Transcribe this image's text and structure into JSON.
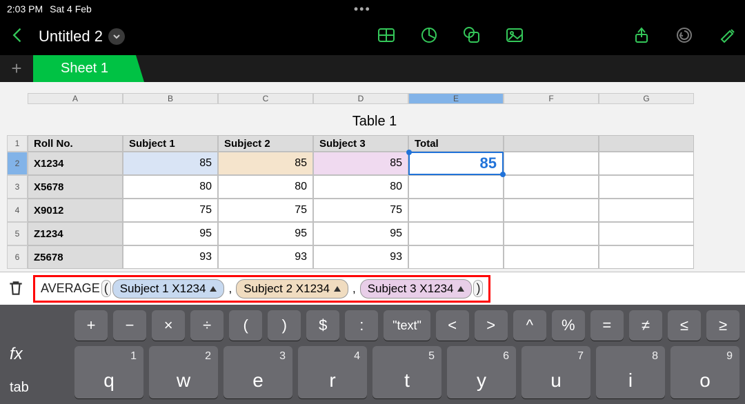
{
  "status": {
    "time": "2:03 PM",
    "date": "Sat 4 Feb"
  },
  "toolbar": {
    "back": "back",
    "title": "Untitled 2"
  },
  "tabbar": {
    "add": "+",
    "tab1": "Sheet 1"
  },
  "table": {
    "title": "Table 1",
    "cols": [
      "A",
      "B",
      "C",
      "D",
      "E",
      "F",
      "G"
    ],
    "rownums": [
      "1",
      "2",
      "3",
      "4",
      "5",
      "6"
    ],
    "headers": {
      "a": "Roll No.",
      "b": "Subject 1",
      "c": "Subject 2",
      "d": "Subject 3",
      "e": "Total"
    },
    "rows": [
      {
        "a": "X1234",
        "b": "85",
        "c": "85",
        "d": "85",
        "e": "85"
      },
      {
        "a": "X5678",
        "b": "80",
        "c": "80",
        "d": "80",
        "e": ""
      },
      {
        "a": "X9012",
        "b": "75",
        "c": "75",
        "d": "75",
        "e": ""
      },
      {
        "a": "Z1234",
        "b": "95",
        "c": "95",
        "d": "95",
        "e": ""
      },
      {
        "a": "Z5678",
        "b": "93",
        "c": "93",
        "d": "93",
        "e": ""
      }
    ]
  },
  "formula": {
    "fn": "AVERAGE",
    "args": [
      {
        "label": "Subject 1 X1234"
      },
      {
        "label": "Subject 2 X1234"
      },
      {
        "label": "Subject 3 X1234"
      }
    ],
    "sep": ","
  },
  "keyboard": {
    "fx": "fx",
    "tab": "tab",
    "ops": [
      "+",
      "−",
      "×",
      "÷",
      "(",
      ")",
      "$",
      ":",
      "\"text\"",
      "<",
      ">",
      "^",
      "%",
      "=",
      "≠",
      "≤",
      "≥"
    ],
    "letters": [
      {
        "n": "1",
        "l": "q"
      },
      {
        "n": "2",
        "l": "w"
      },
      {
        "n": "3",
        "l": "e"
      },
      {
        "n": "4",
        "l": "r"
      },
      {
        "n": "5",
        "l": "t"
      },
      {
        "n": "6",
        "l": "y"
      },
      {
        "n": "7",
        "l": "u"
      },
      {
        "n": "8",
        "l": "i"
      },
      {
        "n": "9",
        "l": "o"
      }
    ]
  }
}
